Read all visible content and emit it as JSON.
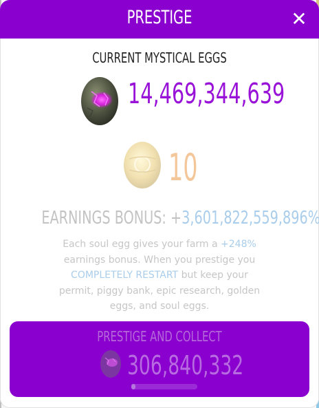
{
  "header": {
    "title": "PRESTIGE",
    "close_symbol": "✕"
  },
  "current": {
    "label": "CURRENT MYSTICAL EGGS",
    "egg_icon": "mystical-egg-icon",
    "amount": "14,469,344,639"
  },
  "soul": {
    "egg_icon": "soul-egg-icon",
    "count": "10"
  },
  "bonus": {
    "label": "EARNINGS BONUS: +",
    "value": "3,601,822,559,896%"
  },
  "description": {
    "part1": "Each soul egg gives your farm a ",
    "percent": "+248%",
    "part2": " earnings bonus. When you prestige you ",
    "restart": "COMPLETELY RESTART",
    "part3": " but keep your permit, piggy bank, epic research, golden eggs, and soul eggs."
  },
  "collect": {
    "label": "PRESTIGE AND COLLECT",
    "amount": "306,840,332",
    "egg_icon": "mystical-egg-icon",
    "progress": 0.05
  },
  "colors": {
    "brand_purple": "#8a00cf",
    "amount_purple": "#9812d8",
    "highlight_blue": "#a9cdea"
  }
}
